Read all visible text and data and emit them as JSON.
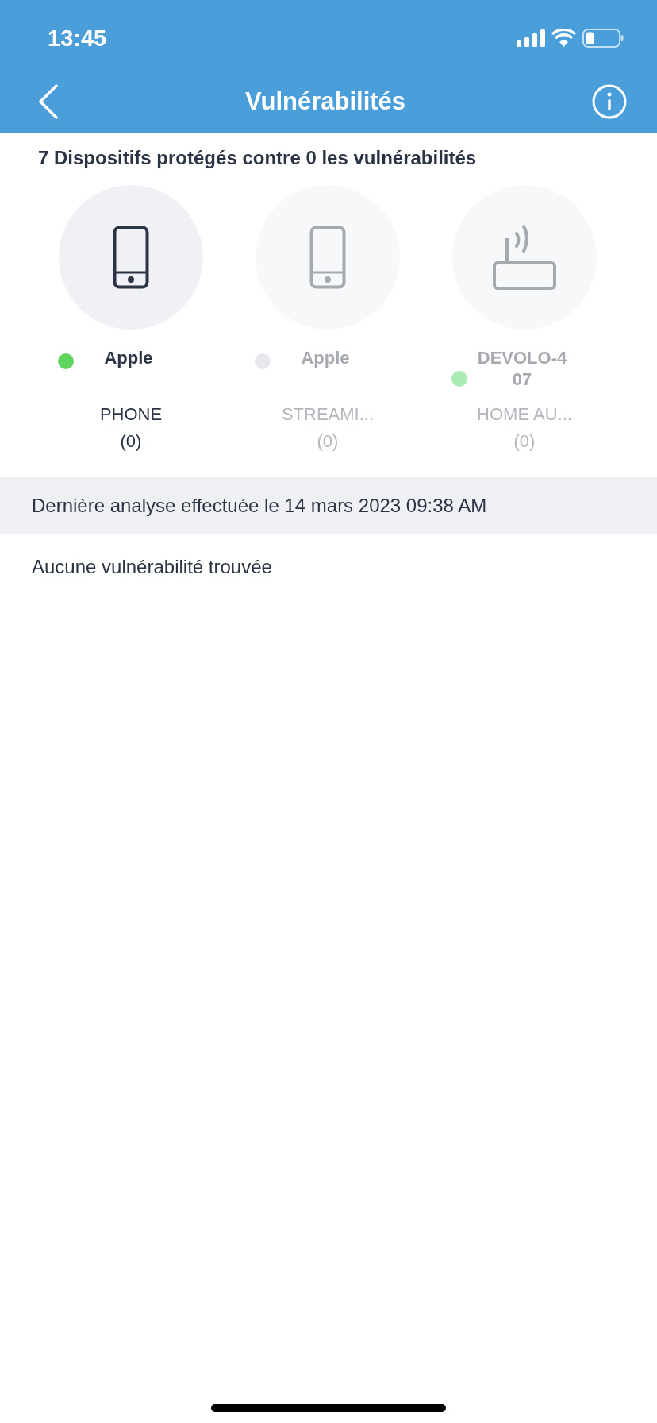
{
  "status_bar": {
    "time": "13:45"
  },
  "nav": {
    "title": "Vulnérabilités"
  },
  "summary": "7 Dispositifs protégés contre 0 les vulnérabilités",
  "devices": [
    {
      "kind": "phone",
      "name": "Apple",
      "type": "PHONE",
      "count": "(0)",
      "selected": true,
      "color": "#5fd55f"
    },
    {
      "kind": "phone",
      "name": "Apple",
      "type": "STREAMI...",
      "count": "(0)",
      "selected": false,
      "color": "#e6e8ed"
    },
    {
      "kind": "router",
      "name": "DEVOLO-407",
      "type": "HOME AU...",
      "count": "(0)",
      "selected": false,
      "color": "#aaeab4"
    }
  ],
  "last_scan": "Dernière analyse effectuée le 14 mars 2023 09:38 AM",
  "result": "Aucune vulnérabilité trouvée"
}
